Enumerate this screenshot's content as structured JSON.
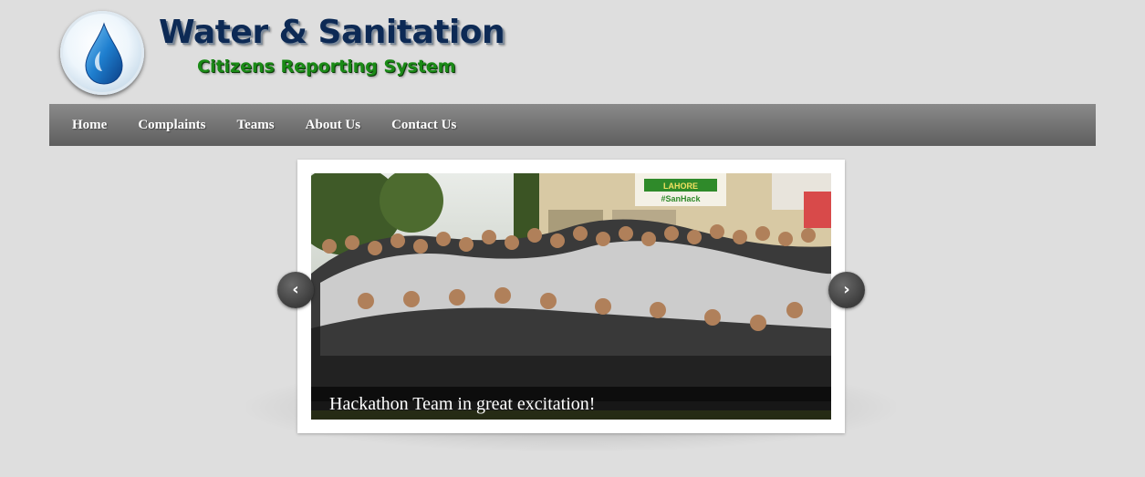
{
  "header": {
    "title": "Water & Sanitation",
    "subtitle": "Citizens Reporting System"
  },
  "nav": {
    "items": [
      {
        "label": "Home"
      },
      {
        "label": "Complaints"
      },
      {
        "label": "Teams"
      },
      {
        "label": "About Us"
      },
      {
        "label": "Contact Us"
      }
    ]
  },
  "slider": {
    "caption": "Hackathon Team in great excitation!",
    "banner_top": "LAHORE",
    "banner_tag": "#SanHack",
    "prev_icon": "chevron-left-icon",
    "next_icon": "chevron-right-icon"
  },
  "colors": {
    "background": "#dedede",
    "navbar": "#767676",
    "title": "#0d2a55",
    "subtitle": "#1a8a16"
  }
}
